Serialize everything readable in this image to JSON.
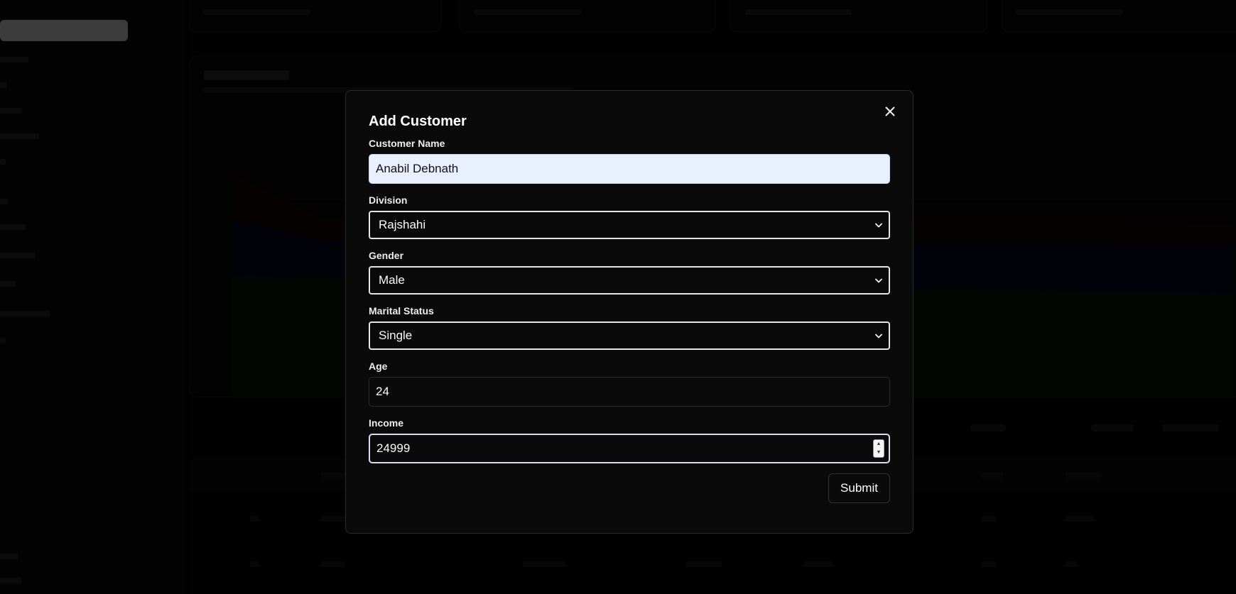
{
  "modal": {
    "title": "Add Customer",
    "fields": {
      "customer_name": {
        "label": "Customer Name",
        "value": "Anabil Debnath"
      },
      "division": {
        "label": "Division",
        "value": "Rajshahi"
      },
      "gender": {
        "label": "Gender",
        "value": "Male"
      },
      "marital_status": {
        "label": "Marital Status",
        "value": "Single"
      },
      "age": {
        "label": "Age",
        "value": "24"
      },
      "income": {
        "label": "Income",
        "value": "24999"
      }
    },
    "submit_label": "Submit"
  },
  "icons": {
    "close": "close-icon",
    "select_chevron": "chevron-down-icon",
    "number_spinner": "number-spinner-icon"
  },
  "colors": {
    "autofill_bg": "#e8f0fe",
    "modal_bg": "#0a0a0a",
    "chart_series": [
      "#5a1616",
      "#1e1e6b",
      "#123a16"
    ]
  }
}
